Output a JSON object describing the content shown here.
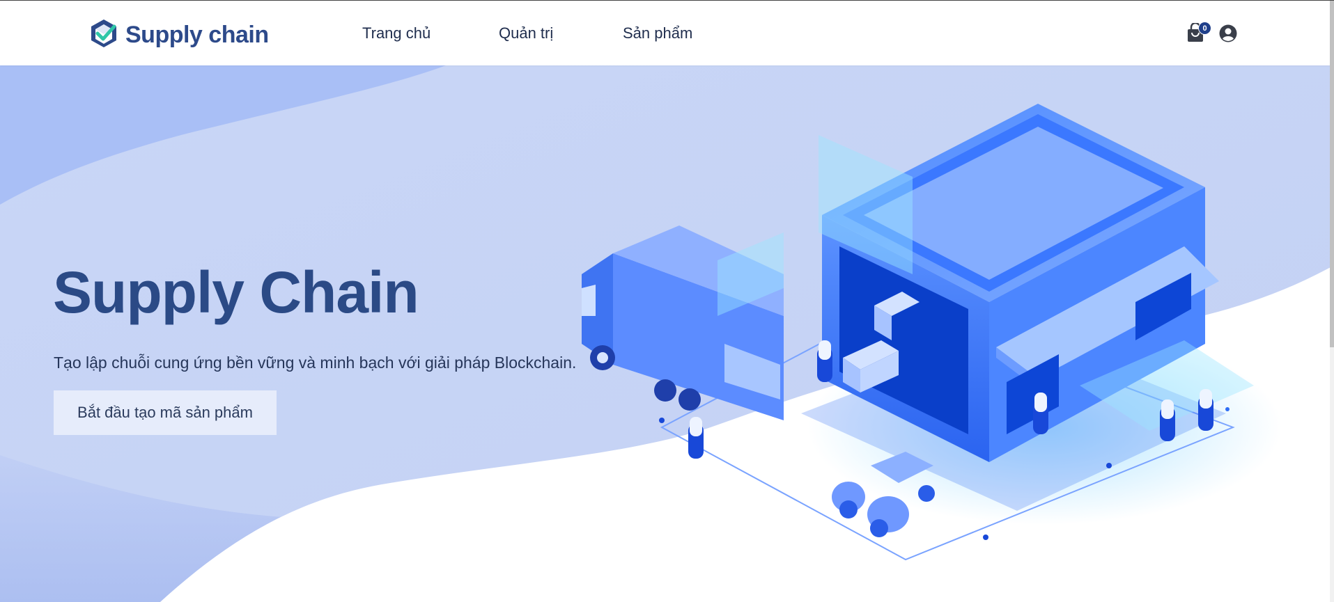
{
  "header": {
    "brand": "Supply chain",
    "nav": [
      {
        "label": "Trang chủ"
      },
      {
        "label": "Quản trị"
      },
      {
        "label": "Sản phẩm"
      }
    ],
    "cart_count": "0"
  },
  "hero": {
    "title": "Supply Chain",
    "subtitle": "Tạo lập chuỗi cung ứng bền vững và minh bạch với giải pháp Blockchain.",
    "cta_label": "Bắt đầu tạo mã sản phẩm"
  },
  "colors": {
    "brand": "#2d4a8a",
    "hero_bg": "#c8d6f6",
    "accent_blue": "#2f6df5"
  },
  "icons": [
    "logo-cube-icon",
    "shopping-bag-icon",
    "user-circle-icon"
  ]
}
